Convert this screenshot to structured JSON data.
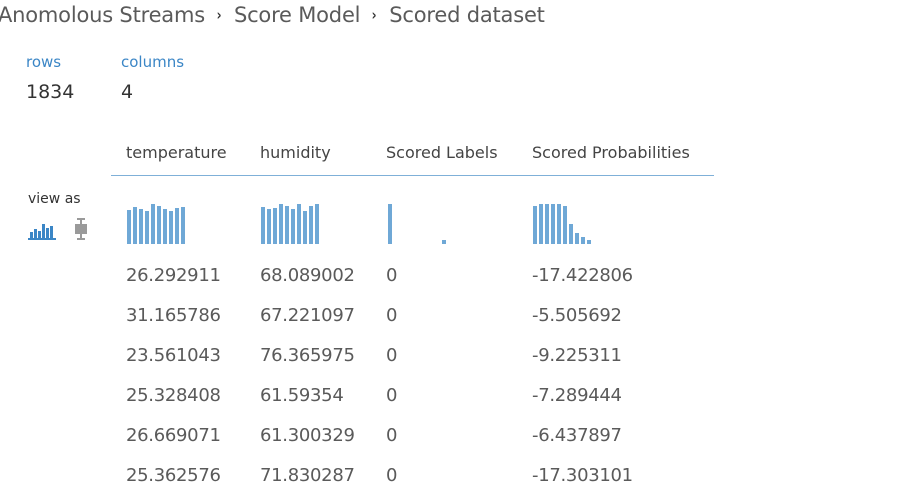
{
  "breadcrumb": [
    "Anomolous Streams",
    "Score Model",
    "Scored dataset"
  ],
  "breadcrumb_separator": "›",
  "stats": {
    "rows_label": "rows",
    "rows_value": "1834",
    "columns_label": "columns",
    "columns_value": "4"
  },
  "table": {
    "columns": [
      "temperature",
      "humidity",
      "Scored Labels",
      "Scored Probabilities"
    ],
    "rows": [
      [
        "26.292911",
        "68.089002",
        "0",
        "-17.422806"
      ],
      [
        "31.165786",
        "67.221097",
        "0",
        "-5.505692"
      ],
      [
        "23.561043",
        "76.365975",
        "0",
        "-9.225311"
      ],
      [
        "25.328408",
        "61.59354",
        "0",
        "-7.289444"
      ],
      [
        "26.669071",
        "61.300329",
        "0",
        "-6.437897"
      ],
      [
        "25.362576",
        "71.830287",
        "0",
        "-17.303101"
      ]
    ]
  },
  "view_as": {
    "label": "view as",
    "options": [
      "histogram-icon",
      "boxplot-icon"
    ],
    "selected": "histogram-icon"
  },
  "histograms": {
    "temperature": [
      0.78,
      0.84,
      0.8,
      0.74,
      0.92,
      0.86,
      0.8,
      0.74,
      0.82,
      0.84
    ],
    "humidity": [
      0.84,
      0.8,
      0.82,
      0.92,
      0.86,
      0.8,
      0.9,
      0.76,
      0.86,
      0.9
    ],
    "Scored Labels": [
      0.9,
      0,
      0,
      0,
      0,
      0,
      0,
      0,
      0,
      0,
      0.1
    ],
    "Scored Probabilities": [
      0.86,
      0.9,
      0.9,
      0.92,
      0.9,
      0.86,
      0.46,
      0.26,
      0.16,
      0.1
    ]
  },
  "colors": {
    "accent": "#3b86c6",
    "bar": "#6fa8d6",
    "rule": "#7fb0d8"
  }
}
